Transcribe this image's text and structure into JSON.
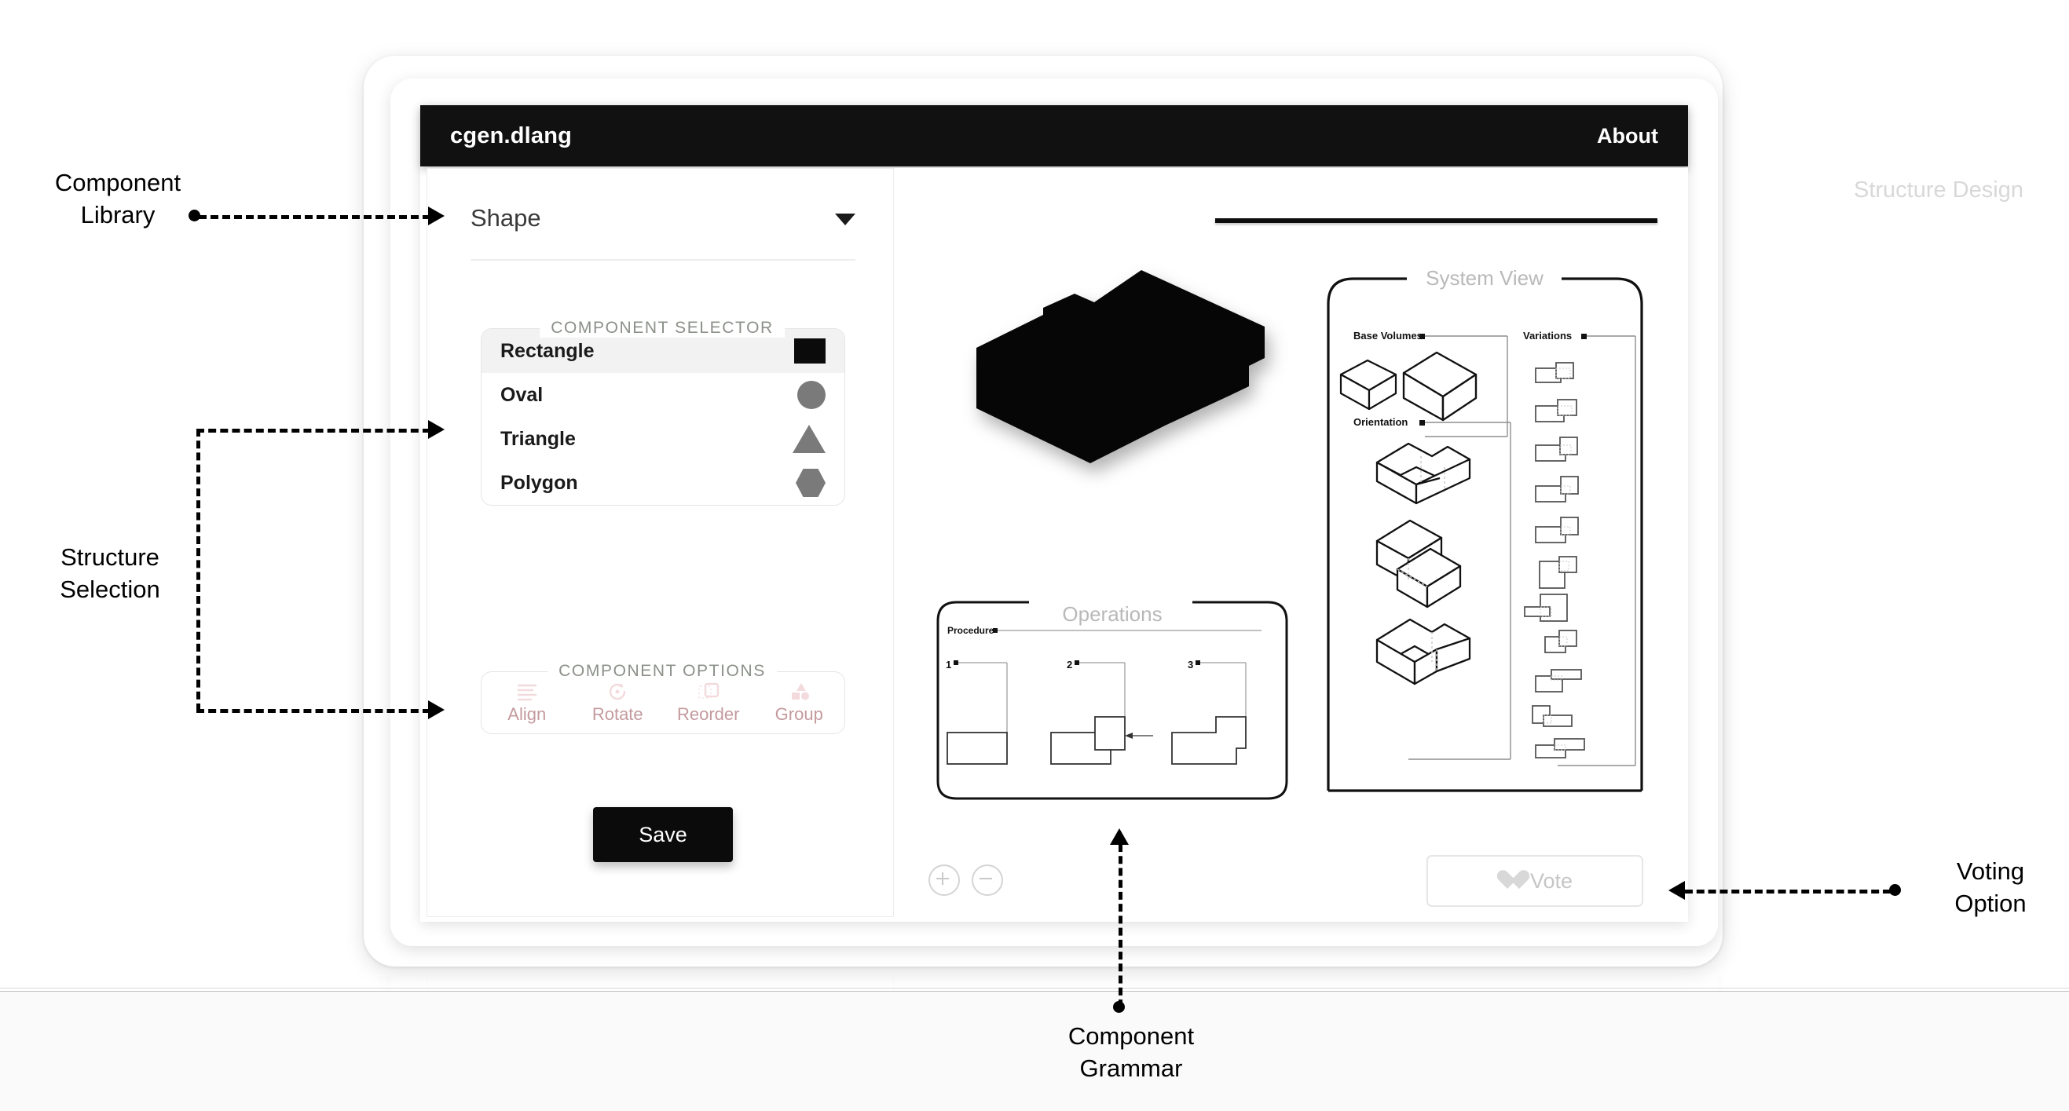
{
  "annotations": [
    {
      "id": "component-library",
      "text": "Component\nLibrary"
    },
    {
      "id": "structure-selection",
      "text": "Structure\nSelection"
    },
    {
      "id": "voting-option",
      "text": "Voting\nOption"
    },
    {
      "id": "component-grammar",
      "text": "Component\nGrammar"
    }
  ],
  "app": {
    "title": "cgen.dlang",
    "about_label": "About"
  },
  "left_panel": {
    "shape_dropdown": {
      "value": "Shape",
      "caret_icon": "chevron-down-icon"
    },
    "component_selector": {
      "legend": "COMPONENT SELECTOR",
      "items": [
        {
          "label": "Rectangle",
          "swatch": "rect-swatch",
          "selected": true
        },
        {
          "label": "Oval",
          "swatch": "circle-swatch",
          "selected": false
        },
        {
          "label": "Triangle",
          "swatch": "triangle-swatch",
          "selected": false
        },
        {
          "label": "Polygon",
          "swatch": "hexagon-swatch",
          "selected": false
        }
      ]
    },
    "component_options": {
      "legend": "COMPONENT OPTIONS",
      "items": [
        {
          "label": "Align",
          "icon": "align-icon"
        },
        {
          "label": "Rotate",
          "icon": "rotate-icon"
        },
        {
          "label": "Reorder",
          "icon": "reorder-icon"
        },
        {
          "label": "Group",
          "icon": "group-icon"
        }
      ]
    },
    "save_label": "Save"
  },
  "canvas": {
    "tab_label": "Structure Design",
    "system_view": {
      "title": "System View",
      "sections": [
        {
          "label": "Base Volumes"
        },
        {
          "label": "Variations"
        },
        {
          "label": "Orientation"
        }
      ]
    },
    "operations": {
      "title": "Operations",
      "procedure_label": "Procedure",
      "steps": [
        "1",
        "2",
        "3"
      ]
    }
  },
  "bottom_bar": {
    "zoom_in_icon": "zoom-in-icon",
    "zoom_out_icon": "zoom-out-icon",
    "vote_label": "Vote",
    "vote_icon": "heart-icon"
  },
  "colors": {
    "header_bg": "#111111",
    "accent_dark": "#0b0b0b",
    "muted_text": "#b9b9b9",
    "disabled_pink": "#c49a9e",
    "swatch_gray": "#7a7a7a"
  }
}
